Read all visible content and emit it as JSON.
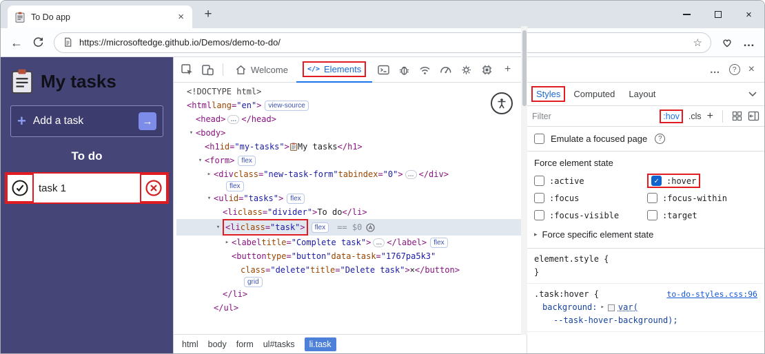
{
  "window": {
    "tab_title": "To Do app",
    "url": "https://microsoftedge.github.io/Demos/demo-to-do/"
  },
  "icons": {
    "tab_close": "×",
    "new_tab": "+",
    "close": "×",
    "back": "←",
    "star": "☆",
    "more": "…",
    "elements_glyph": "</>",
    "help": "?",
    "plus": "+",
    "menu_dots": "…",
    "question": "?"
  },
  "app": {
    "title": "My tasks",
    "add_plus": "+",
    "add_label": "Add a task",
    "add_arrow": "→",
    "section_heading": "To do",
    "task_label": "task 1"
  },
  "devtools": {
    "tab_welcome": "Welcome",
    "tab_elements": "Elements",
    "dom_lines": [
      {
        "i": 0,
        "a": "",
        "tk": [
          {
            "t": "doc",
            "s": "<!DOCTYPE html>"
          }
        ]
      },
      {
        "i": 0,
        "a": "",
        "tk": [
          {
            "t": "tag",
            "s": "<html"
          },
          {
            "t": "attr",
            "s": " lang"
          },
          {
            "t": "punc",
            "s": "="
          },
          {
            "t": "val",
            "s": "\"en\""
          },
          {
            "t": "tag",
            "s": ">"
          },
          {
            "t": "badge",
            "s": "view-source"
          }
        ]
      },
      {
        "i": 1,
        "a": "",
        "tk": [
          {
            "t": "tag",
            "s": "<head>"
          },
          {
            "t": "ell"
          },
          {
            "t": "tag",
            "s": "</head>"
          }
        ]
      },
      {
        "i": 1,
        "a": "v",
        "tk": [
          {
            "t": "tag",
            "s": "<body>"
          }
        ]
      },
      {
        "i": 2,
        "a": "",
        "tk": [
          {
            "t": "tag",
            "s": "<h1"
          },
          {
            "t": "attr",
            "s": " id"
          },
          {
            "t": "punc",
            "s": "="
          },
          {
            "t": "val",
            "s": "\"my-tasks\""
          },
          {
            "t": "tag",
            "s": ">"
          },
          {
            "t": "clip"
          },
          {
            "t": "txt",
            "s": " My tasks"
          },
          {
            "t": "tag",
            "s": "</h1>"
          }
        ]
      },
      {
        "i": 2,
        "a": "v",
        "tk": [
          {
            "t": "tag",
            "s": "<form>"
          },
          {
            "t": "badge",
            "s": "flex"
          }
        ]
      },
      {
        "i": 3,
        "a": "r",
        "tk": [
          {
            "t": "tag",
            "s": "<div"
          },
          {
            "t": "attr",
            "s": " class"
          },
          {
            "t": "punc",
            "s": "="
          },
          {
            "t": "val",
            "s": "\"new-task-form\""
          },
          {
            "t": "attr",
            "s": " tabindex"
          },
          {
            "t": "punc",
            "s": "="
          },
          {
            "t": "val",
            "s": "\"0\""
          },
          {
            "t": "tag",
            "s": ">"
          },
          {
            "t": "ell"
          },
          {
            "t": "tag",
            "s": "</div>"
          }
        ]
      },
      {
        "i": 4,
        "a": "",
        "tk": [
          {
            "t": "badge",
            "s": "flex"
          }
        ]
      },
      {
        "i": 3,
        "a": "v",
        "tk": [
          {
            "t": "tag",
            "s": "<ul"
          },
          {
            "t": "attr",
            "s": " id"
          },
          {
            "t": "punc",
            "s": "="
          },
          {
            "t": "val",
            "s": "\"tasks\""
          },
          {
            "t": "tag",
            "s": ">"
          },
          {
            "t": "badge",
            "s": "flex"
          }
        ]
      },
      {
        "i": 4,
        "a": "",
        "tk": [
          {
            "t": "tag",
            "s": "<li"
          },
          {
            "t": "attr",
            "s": " class"
          },
          {
            "t": "punc",
            "s": "="
          },
          {
            "t": "val",
            "s": "\"divider\""
          },
          {
            "t": "tag",
            "s": ">"
          },
          {
            "t": "txt",
            "s": "To do"
          },
          {
            "t": "tag",
            "s": "</li>"
          }
        ]
      },
      {
        "i": 4,
        "a": "v",
        "sel": true,
        "tk": [
          {
            "t": "group",
            "tk": [
              {
                "t": "tag",
                "s": "<li"
              },
              {
                "t": "attr",
                "s": " class"
              },
              {
                "t": "punc",
                "s": "="
              },
              {
                "t": "val",
                "s": "\"task\""
              },
              {
                "t": "tag",
                "s": ">"
              }
            ]
          },
          {
            "t": "badge",
            "s": "flex"
          },
          {
            "t": "eq",
            "s": "== $0"
          },
          {
            "t": "adorner"
          }
        ]
      },
      {
        "i": 5,
        "a": "r",
        "tk": [
          {
            "t": "tag",
            "s": "<label"
          },
          {
            "t": "attr",
            "s": " title"
          },
          {
            "t": "punc",
            "s": "="
          },
          {
            "t": "val",
            "s": "\"Complete task\""
          },
          {
            "t": "tag",
            "s": ">"
          },
          {
            "t": "ell"
          },
          {
            "t": "tag",
            "s": "</label>"
          },
          {
            "t": "badge",
            "s": "flex"
          }
        ]
      },
      {
        "i": 5,
        "a": "",
        "tk": [
          {
            "t": "tag",
            "s": "<button"
          },
          {
            "t": "attr",
            "s": " type"
          },
          {
            "t": "punc",
            "s": "="
          },
          {
            "t": "val",
            "s": "\"button\""
          },
          {
            "t": "attr",
            "s": " data-task"
          },
          {
            "t": "punc",
            "s": "="
          },
          {
            "t": "val",
            "s": "\"1767pa5k3\""
          }
        ]
      },
      {
        "i": 6,
        "a": "",
        "tk": [
          {
            "t": "attr",
            "s": "class"
          },
          {
            "t": "punc",
            "s": "="
          },
          {
            "t": "val",
            "s": "\"delete\""
          },
          {
            "t": "attr",
            "s": " title"
          },
          {
            "t": "punc",
            "s": "="
          },
          {
            "t": "val",
            "s": "\"Delete task\""
          },
          {
            "t": "tag",
            "s": ">"
          },
          {
            "t": "txt",
            "s": "×"
          },
          {
            "t": "tag",
            "s": "</button>"
          }
        ]
      },
      {
        "i": 6,
        "a": "",
        "tk": [
          {
            "t": "badge",
            "s": "grid"
          }
        ]
      },
      {
        "i": 4,
        "a": "",
        "tk": [
          {
            "t": "tag",
            "s": "</li>"
          }
        ]
      },
      {
        "i": 3,
        "a": "",
        "tk": [
          {
            "t": "tag",
            "s": "</ul>"
          }
        ]
      }
    ],
    "breadcrumbs": [
      {
        "label": "html"
      },
      {
        "label": "body"
      },
      {
        "label": "form"
      },
      {
        "label": "ul#tasks"
      },
      {
        "label": "li.task",
        "active": true
      }
    ],
    "styles": {
      "tab_styles": "Styles",
      "tab_computed": "Computed",
      "tab_layout": "Layout",
      "filter_placeholder": "Filter",
      "hov_label": ":hov",
      "cls_label": ".cls",
      "emulate_label": "Emulate a focused page",
      "force_title": "Force element state",
      "states": [
        {
          "label": ":active"
        },
        {
          "label": ":hover",
          "checked": true,
          "boxed": true
        },
        {
          "label": ":focus"
        },
        {
          "label": ":focus-within"
        },
        {
          "label": ":focus-visible"
        },
        {
          "label": ":target"
        }
      ],
      "force_specific": "Force specific element state",
      "element_style_selector": "element.style",
      "brace_open": "{",
      "brace_close": "}",
      "rule_selector": ".task:hover",
      "rule_link": "to-do-styles.css:96",
      "rule_property": "background:",
      "rule_value_fn": "var(",
      "rule_value_arg": "--task-hover-background);"
    }
  }
}
